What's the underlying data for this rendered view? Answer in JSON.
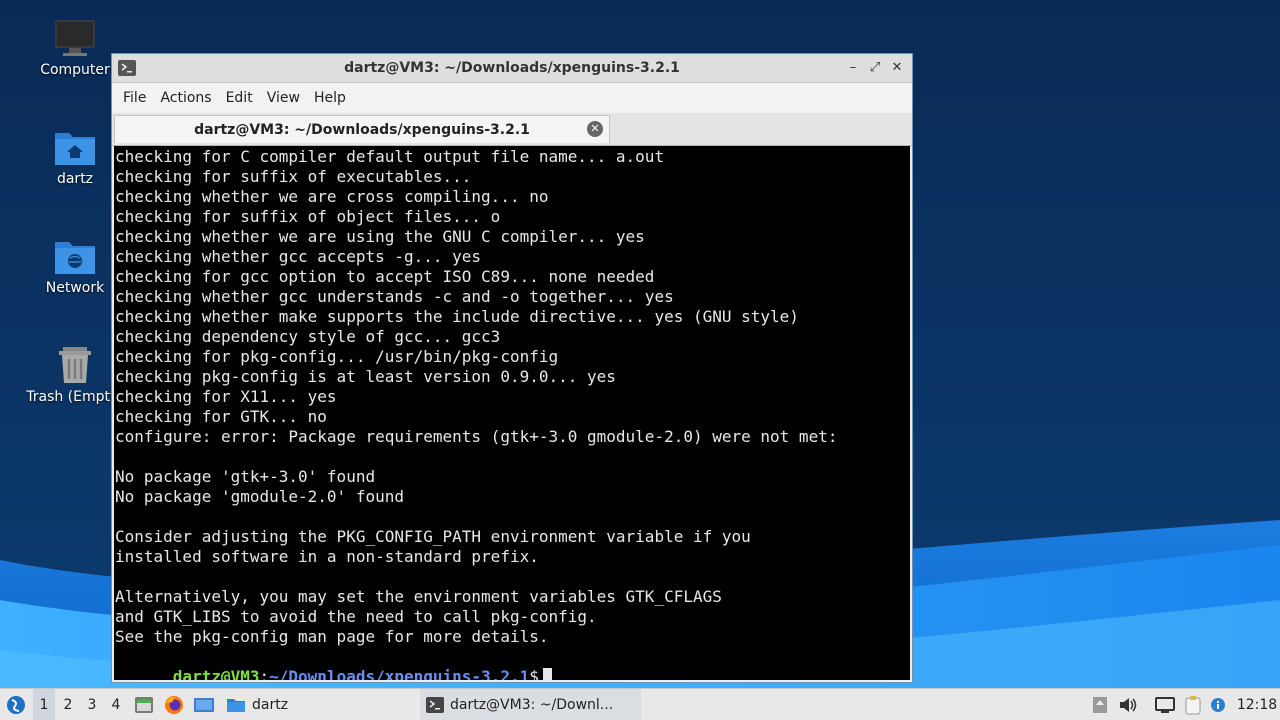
{
  "desktop": {
    "icons": [
      {
        "label": "Computer",
        "icon": "computer-icon"
      },
      {
        "label": "dartz",
        "icon": "home-folder-icon"
      },
      {
        "label": "Network",
        "icon": "network-folder-icon"
      },
      {
        "label": "Trash (Empty)",
        "icon": "trash-icon"
      }
    ]
  },
  "window": {
    "title": "dartz@VM3: ~/Downloads/xpenguins-3.2.1",
    "controls": {
      "minimize": "–",
      "maximize": "⤢",
      "close": "✕"
    },
    "menu": [
      "File",
      "Actions",
      "Edit",
      "View",
      "Help"
    ],
    "tab": {
      "label": "dartz@VM3: ~/Downloads/xpenguins-3.2.1",
      "close": "✕"
    },
    "terminal": {
      "lines": [
        "checking for C compiler default output file name... a.out",
        "checking for suffix of executables...",
        "checking whether we are cross compiling... no",
        "checking for suffix of object files... o",
        "checking whether we are using the GNU C compiler... yes",
        "checking whether gcc accepts -g... yes",
        "checking for gcc option to accept ISO C89... none needed",
        "checking whether gcc understands -c and -o together... yes",
        "checking whether make supports the include directive... yes (GNU style)",
        "checking dependency style of gcc... gcc3",
        "checking for pkg-config... /usr/bin/pkg-config",
        "checking pkg-config is at least version 0.9.0... yes",
        "checking for X11... yes",
        "checking for GTK... no",
        "configure: error: Package requirements (gtk+-3.0 gmodule-2.0) were not met:",
        "",
        "No package 'gtk+-3.0' found",
        "No package 'gmodule-2.0' found",
        "",
        "Consider adjusting the PKG_CONFIG_PATH environment variable if you",
        "installed software in a non-standard prefix.",
        "",
        "Alternatively, you may set the environment variables GTK_CFLAGS",
        "and GTK_LIBS to avoid the need to call pkg-config.",
        "See the pkg-config man page for more details."
      ],
      "prompt": {
        "user_host": "dartz@VM3",
        "colon": ":",
        "path": "~/Downloads/xpenguins-3.2.1",
        "symbol": "$"
      }
    }
  },
  "taskbar": {
    "workspaces": [
      "1",
      "2",
      "3",
      "4"
    ],
    "active_workspace": "1",
    "launchers": [
      "start-menu-icon",
      "file-manager-icon",
      "firefox-icon",
      "desktop-icon"
    ],
    "folder_task": "dartz",
    "terminal_task": "dartz@VM3: ~/Downl...",
    "clock": "12:18"
  },
  "colors": {
    "prompt_user": "#7ee03a",
    "prompt_path": "#6a8df7",
    "terminal_bg": "#000000",
    "desktop_bg": "#0a2d5a"
  }
}
